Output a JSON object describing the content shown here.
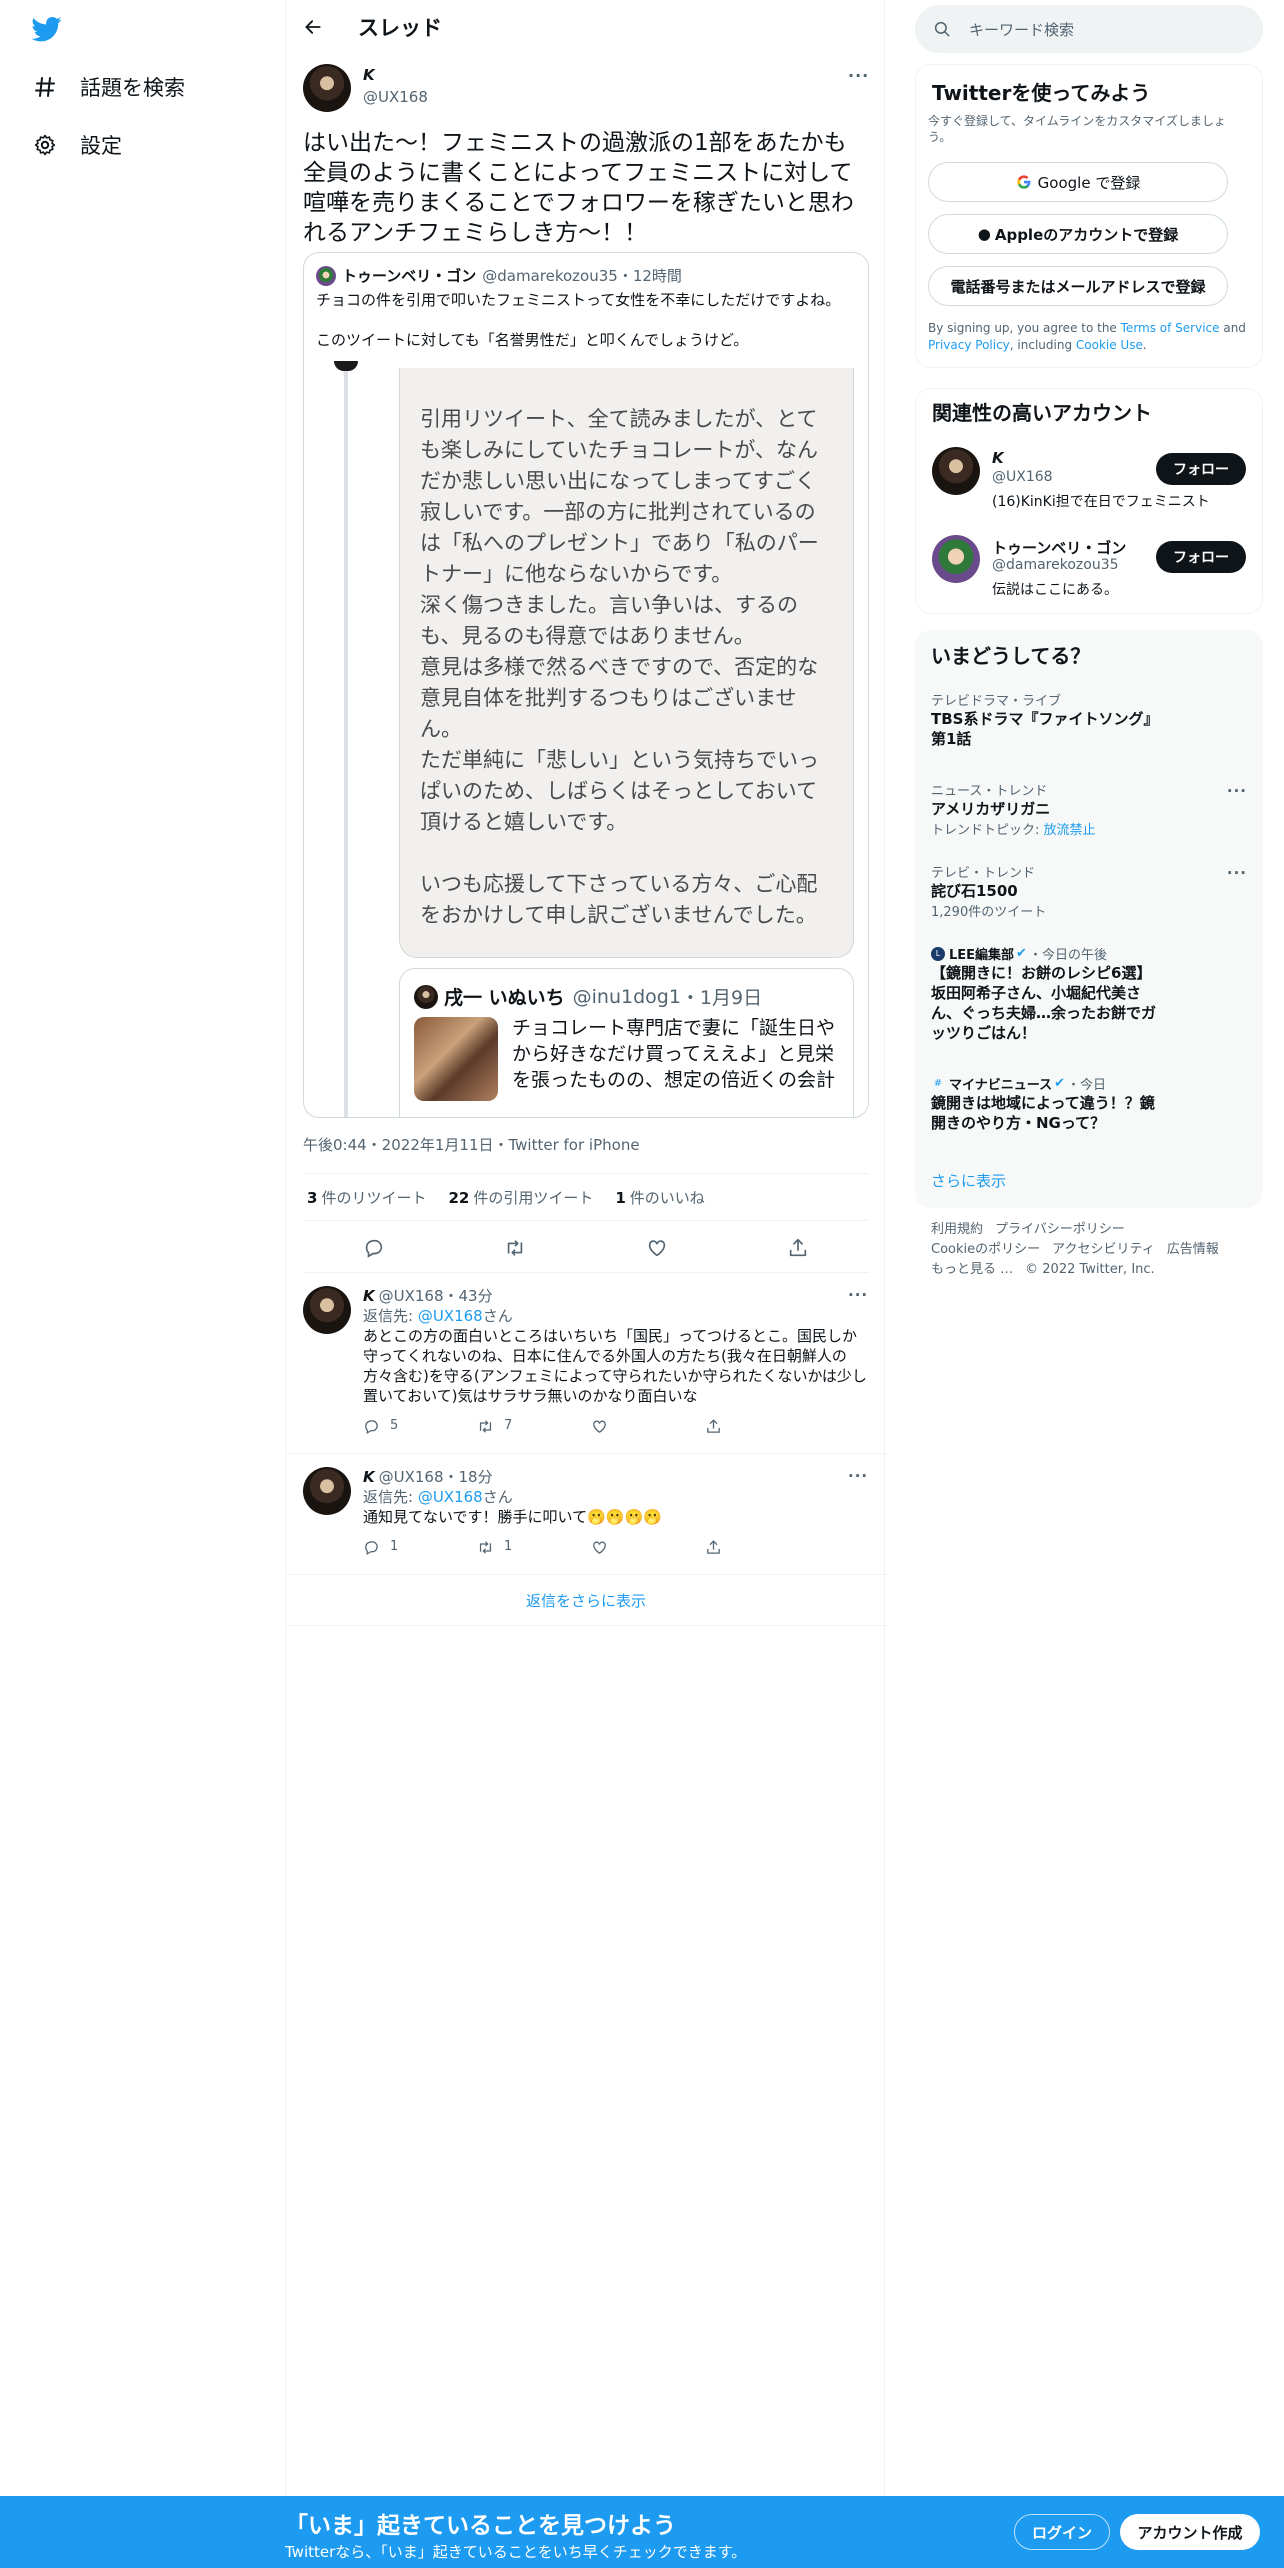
{
  "nav": {
    "explore": "話題を検索",
    "settings": "設定"
  },
  "header": {
    "title": "スレッド"
  },
  "tweet": {
    "name": "𝙆",
    "handle": "@UX168",
    "text": "はい出た〜！フェミニストの過激派の1部をあたかも全員のように書くことによってフェミニストに対して喧嘩を売りまくることでフォロワーを稼ぎたいと思われるアンチフェミらしき方〜！！",
    "timestamp": "午後0:44・2022年1月11日・Twitter for iPhone",
    "stats": {
      "retweets_count": "3",
      "retweets_label": "件のリツイート",
      "quotes_count": "22",
      "quotes_label": "件の引用ツイート",
      "likes_count": "1",
      "likes_label": "件のいいね"
    }
  },
  "quote": {
    "name": "トゥーンベリ・ゴン",
    "handle": "@damarekozou35",
    "time": "・12時間",
    "line1": "チョコの件を引用で叩いたフェミニストって女性を不幸にしただけですよね。",
    "line2": "このツイートに対しても「名誉男性だ」と叩くんでしょうけど。",
    "image_text": "引用リツイート、全て読みましたが、とても楽しみにしていたチョコレートが、なんだか悲しい思い出になってしまってすごく寂しいです。一部の方に批判されているのは「私へのプレゼント」であり「私のパートナー」に他ならないからです。\n深く傷つきました。言い争いは、するのも、見るのも得意ではありません。\n意見は多様で然るべきですので、否定的な意見自体を批判するつもりはございません。\nただ単純に「悲しい」という気持ちでいっぱいのため、しばらくはそっとしておいて頂けると嬉しいです。\n\nいつも応援して下さっている方々、ご心配をおかけして申し訳ございませんでした。",
    "card": {
      "name": "戌一 いぬいち",
      "handle": "@inu1dog1",
      "date": "・1月9日",
      "text": "チョコレート専門店で妻に「誕生日やから好きなだけ買ってええよ」と見栄を張ったものの、想定の倍近くの会計に「さすがに買いすぎやろ！」という"
    }
  },
  "replies": [
    {
      "name": "𝙆",
      "handle": "@UX168",
      "time": "・43分",
      "reply_to_prefix": "返信先: ",
      "reply_to": "@UX168",
      "reply_to_suffix": "さん",
      "text": "あとこの方の面白いところはいちいち「国民」ってつけるとこ。国民しか守ってくれないのね、日本に住んでる外国人の方たち(我々在日朝鮮人の方々含む)を守る(アンフェミによって守られたいか守られたくないかは少し置いておいて)気はサラサラ無いのかなり面白いな",
      "replies": "5",
      "retweets": "7",
      "likes": ""
    },
    {
      "name": "𝙆",
      "handle": "@UX168",
      "time": "・18分",
      "reply_to_prefix": "返信先: ",
      "reply_to": "@UX168",
      "reply_to_suffix": "さん",
      "text": "通知見てないです！勝手に叩いて🫢🫢🫢🫢",
      "replies": "1",
      "retweets": "1",
      "likes": ""
    }
  ],
  "show_more_replies": "返信をさらに表示",
  "search": {
    "placeholder": "キーワード検索"
  },
  "signup": {
    "title": "Twitterを使ってみよう",
    "subtitle": "今すぐ登録して、タイムラインをカスタマイズしましょう。",
    "google": "Google で登録",
    "apple": "Appleのアカウントで登録",
    "phone": "電話番号またはメールアドレスで登録",
    "terms_prefix": "By signing up, you agree to the ",
    "terms": "Terms of Service",
    "and": " and ",
    "privacy": "Privacy Policy",
    "including": ", including ",
    "cookie": "Cookie Use",
    "period": "."
  },
  "related": {
    "title": "関連性の高いアカウント",
    "accounts": [
      {
        "name": "𝙆",
        "handle": "@UX168",
        "bio": "(16)KinKi担で在日でフェミニスト",
        "button": "フォロー"
      },
      {
        "name": "トゥーンベリ・ゴン",
        "handle": "@damarekozou35",
        "bio": "伝説はここにある。",
        "button": "フォロー"
      }
    ]
  },
  "trends": {
    "title": "いまどうしてる？",
    "items": [
      {
        "category": "テレビドラマ・ライブ",
        "name": "TBS系ドラマ『ファイトソング』第1話"
      },
      {
        "category": "ニュース・トレンド",
        "name": "アメリカザリガニ",
        "sub_prefix": "トレンドトピック: ",
        "sub_link": "放流禁止"
      },
      {
        "category": "テレビ・トレンド",
        "name": "詫び石1500",
        "sub": "1,290件のツイート"
      },
      {
        "source": "LEE編集部",
        "time": "・今日の午後",
        "name": "【鏡開きに！お餅のレシピ6選】坂田阿希子さん、小堀紀代美さん、ぐっち夫婦…余ったお餅でガッツりごはん！"
      },
      {
        "source": "マイナビニュース",
        "time": "・今日",
        "name": "鏡開きは地域によって違う！？鏡開きのやり方・NGって？"
      }
    ],
    "show_more": "さらに表示"
  },
  "footer": {
    "terms": "利用規約",
    "privacy": "プライバシーポリシー",
    "cookie": "Cookieのポリシー",
    "accessibility": "アクセシビリティ",
    "ads": "広告情報",
    "more": "もっと見る …",
    "copyright": "© 2022 Twitter, Inc."
  },
  "banner": {
    "headline": "「いま」起きていることを見つけよう",
    "sub": "Twitterなら、「いま」起きていることをいち早くチェックできます。",
    "login": "ログイン",
    "signup": "アカウント作成"
  },
  "colors": {
    "accent": "#1d9bf0",
    "text": "#0f1419",
    "muted": "#536471"
  }
}
